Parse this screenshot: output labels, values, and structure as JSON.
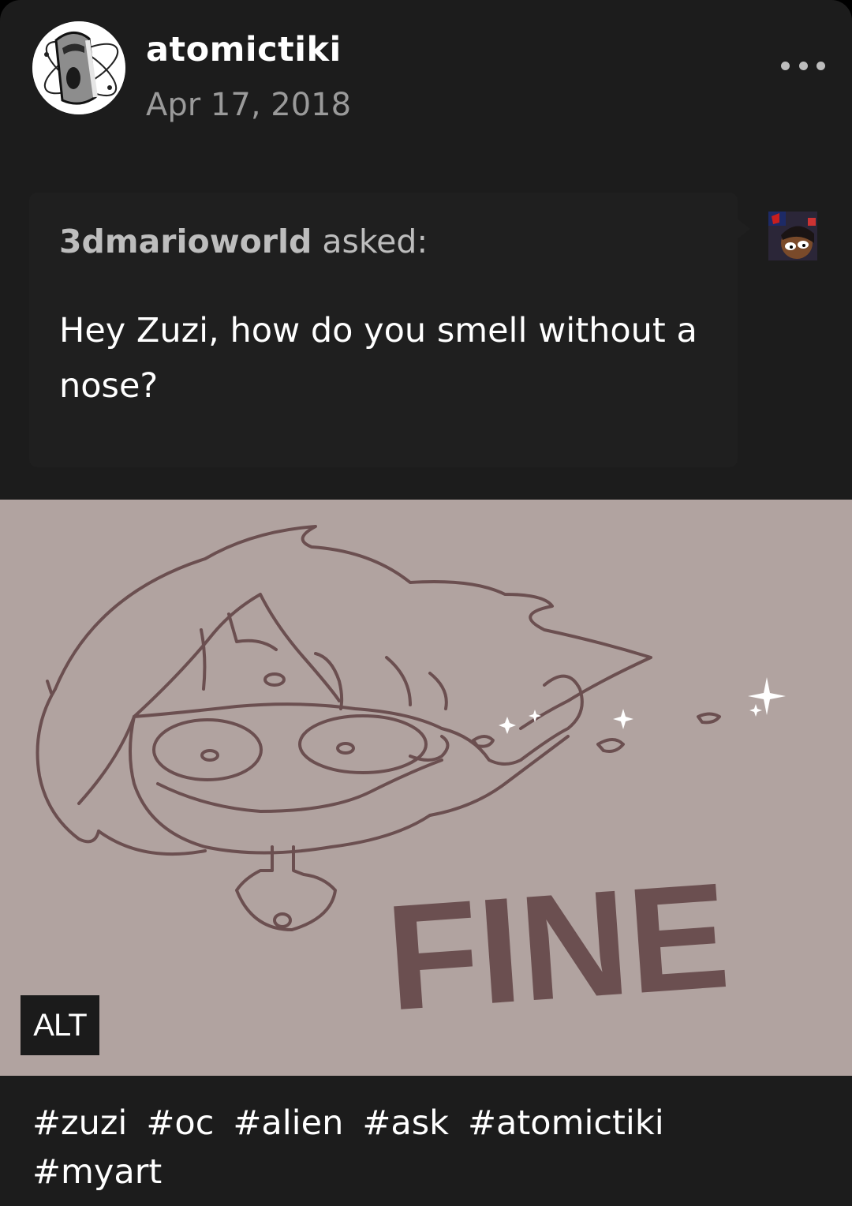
{
  "post": {
    "username": "atomictiki",
    "date": "Apr 17, 2018",
    "more_icon": "ellipsis-icon",
    "avatar_icon": "moai-atom-avatar"
  },
  "ask": {
    "asker_name": "3dmarioworld",
    "asked_suffix": " asked:",
    "question": "Hey Zuzi, how do you smell without a nose?",
    "asker_avatar_icon": "asker-avatar"
  },
  "image": {
    "alt_label": "ALT",
    "drawn_text": "FINE",
    "background": "#b1a3a0",
    "line_color": "#6b4f50"
  },
  "tags": [
    "#zuzi",
    "#oc",
    "#alien",
    "#ask",
    "#atomictiki",
    "#myart"
  ],
  "colors": {
    "card_bg": "#1c1c1c",
    "secondary_text": "#9a9a9a",
    "primary_text": "#ffffff"
  }
}
